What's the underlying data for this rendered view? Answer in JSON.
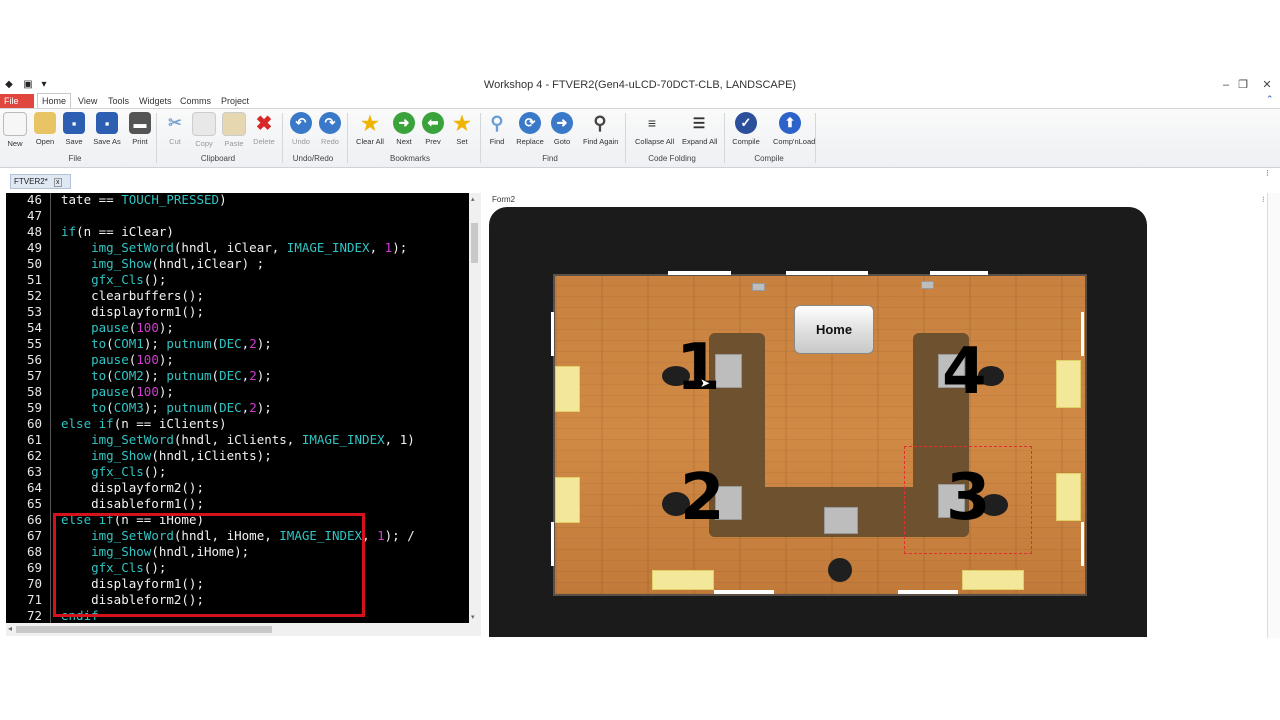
{
  "window": {
    "title": "Workshop 4 - FTVER2(Gen4-uLCD-70DCT-CLB, LANDSCAPE)",
    "minimize": "–",
    "restore": "❐",
    "close": "✕"
  },
  "menu": {
    "file": "File",
    "home": "Home",
    "view": "View",
    "tools": "Tools",
    "widgets": "Widgets",
    "comms": "Comms",
    "project": "Project"
  },
  "ribbon": {
    "buttons": {
      "new": "New",
      "open": "Open",
      "save": "Save",
      "save_as": "Save As",
      "print": "Print",
      "cut": "Cut",
      "copy": "Copy",
      "paste": "Paste",
      "delete": "Delete",
      "undo": "Undo",
      "redo": "Redo",
      "clear_all": "Clear All",
      "next": "Next",
      "prev": "Prev",
      "set": "Set",
      "find": "Find",
      "replace": "Replace",
      "goto": "Goto",
      "find_again": "Find Again",
      "collapse_all": "Collapse All",
      "expand_all": "Expand All",
      "compile": "Compile",
      "comp_load": "Comp'nLoad"
    },
    "groups": {
      "file": "File",
      "clipboard": "Clipboard",
      "undo_redo": "Undo/Redo",
      "bookmarks": "Bookmarks",
      "find": "Find",
      "code_folding": "Code Folding",
      "compile": "Compile"
    }
  },
  "doc_tab": {
    "label": "FTVER2*",
    "close": "x"
  },
  "editor": {
    "lines": [
      {
        "n": "46",
        "t": [
          [
            "plain",
            "tate == "
          ],
          [
            "fn",
            "TOUCH_PRESSED"
          ],
          [
            "plain",
            ")"
          ]
        ]
      },
      {
        "n": "47",
        "t": []
      },
      {
        "n": "48",
        "t": [
          [
            "fn",
            "if"
          ],
          [
            "plain",
            "(n == iClear)"
          ]
        ]
      },
      {
        "n": "49",
        "t": [
          [
            "plain",
            "    "
          ],
          [
            "fn",
            "img_SetWord"
          ],
          [
            "plain",
            "(hndl, iClear, "
          ],
          [
            "fn",
            "IMAGE_INDEX"
          ],
          [
            "plain",
            ", "
          ],
          [
            "num",
            "1"
          ],
          [
            "plain",
            ");"
          ]
        ]
      },
      {
        "n": "50",
        "t": [
          [
            "plain",
            "    "
          ],
          [
            "fn",
            "img_Show"
          ],
          [
            "plain",
            "(hndl,iClear) ;"
          ]
        ]
      },
      {
        "n": "51",
        "t": [
          [
            "plain",
            "    "
          ],
          [
            "fn",
            "gfx_Cls"
          ],
          [
            "plain",
            "();"
          ]
        ]
      },
      {
        "n": "52",
        "t": [
          [
            "plain",
            "    clearbuffers();"
          ]
        ]
      },
      {
        "n": "53",
        "t": [
          [
            "plain",
            "    displayform1();"
          ]
        ]
      },
      {
        "n": "54",
        "t": [
          [
            "plain",
            "    "
          ],
          [
            "fn",
            "pause"
          ],
          [
            "plain",
            "("
          ],
          [
            "num",
            "100"
          ],
          [
            "plain",
            ");"
          ]
        ]
      },
      {
        "n": "55",
        "t": [
          [
            "plain",
            "    "
          ],
          [
            "fn",
            "to"
          ],
          [
            "plain",
            "("
          ],
          [
            "fn",
            "COM1"
          ],
          [
            "plain",
            "); "
          ],
          [
            "fn",
            "putnum"
          ],
          [
            "plain",
            "("
          ],
          [
            "fn",
            "DEC"
          ],
          [
            "plain",
            ","
          ],
          [
            "num",
            "2"
          ],
          [
            "plain",
            ");"
          ]
        ]
      },
      {
        "n": "56",
        "t": [
          [
            "plain",
            "    "
          ],
          [
            "fn",
            "pause"
          ],
          [
            "plain",
            "("
          ],
          [
            "num",
            "100"
          ],
          [
            "plain",
            ");"
          ]
        ]
      },
      {
        "n": "57",
        "t": [
          [
            "plain",
            "    "
          ],
          [
            "fn",
            "to"
          ],
          [
            "plain",
            "("
          ],
          [
            "fn",
            "COM2"
          ],
          [
            "plain",
            "); "
          ],
          [
            "fn",
            "putnum"
          ],
          [
            "plain",
            "("
          ],
          [
            "fn",
            "DEC"
          ],
          [
            "plain",
            ","
          ],
          [
            "num",
            "2"
          ],
          [
            "plain",
            ");"
          ]
        ]
      },
      {
        "n": "58",
        "t": [
          [
            "plain",
            "    "
          ],
          [
            "fn",
            "pause"
          ],
          [
            "plain",
            "("
          ],
          [
            "num",
            "100"
          ],
          [
            "plain",
            ");"
          ]
        ]
      },
      {
        "n": "59",
        "t": [
          [
            "plain",
            "    "
          ],
          [
            "fn",
            "to"
          ],
          [
            "plain",
            "("
          ],
          [
            "fn",
            "COM3"
          ],
          [
            "plain",
            "); "
          ],
          [
            "fn",
            "putnum"
          ],
          [
            "plain",
            "("
          ],
          [
            "fn",
            "DEC"
          ],
          [
            "plain",
            ","
          ],
          [
            "num",
            "2"
          ],
          [
            "plain",
            ");"
          ]
        ]
      },
      {
        "n": "60",
        "t": [
          [
            "fn",
            "else if"
          ],
          [
            "plain",
            "(n == iClients)"
          ]
        ]
      },
      {
        "n": "61",
        "t": [
          [
            "plain",
            "    "
          ],
          [
            "fn",
            "img_SetWord"
          ],
          [
            "plain",
            "(hndl, iClients, "
          ],
          [
            "fn",
            "IMAGE_INDEX"
          ],
          [
            "plain",
            ", 1)"
          ]
        ]
      },
      {
        "n": "62",
        "t": [
          [
            "plain",
            "    "
          ],
          [
            "fn",
            "img_Show"
          ],
          [
            "plain",
            "(hndl,iClients);"
          ]
        ]
      },
      {
        "n": "63",
        "t": [
          [
            "plain",
            "    "
          ],
          [
            "fn",
            "gfx_Cls"
          ],
          [
            "plain",
            "();"
          ]
        ]
      },
      {
        "n": "64",
        "t": [
          [
            "plain",
            "    displayform2();"
          ]
        ]
      },
      {
        "n": "65",
        "t": [
          [
            "plain",
            "    disableform1();"
          ]
        ]
      },
      {
        "n": "66",
        "t": [
          [
            "fn",
            "else if"
          ],
          [
            "plain",
            "(n == iHome)"
          ]
        ]
      },
      {
        "n": "67",
        "t": [
          [
            "plain",
            "    "
          ],
          [
            "fn",
            "img_SetWord"
          ],
          [
            "plain",
            "(hndl, iHome, "
          ],
          [
            "fn",
            "IMAGE_INDEX"
          ],
          [
            "plain",
            ", "
          ],
          [
            "num",
            "1"
          ],
          [
            "plain",
            "); /"
          ]
        ]
      },
      {
        "n": "68",
        "t": [
          [
            "plain",
            "    "
          ],
          [
            "fn",
            "img_Show"
          ],
          [
            "plain",
            "(hndl,iHome);"
          ]
        ]
      },
      {
        "n": "69",
        "t": [
          [
            "plain",
            "    "
          ],
          [
            "fn",
            "gfx_Cls"
          ],
          [
            "plain",
            "();"
          ]
        ]
      },
      {
        "n": "70",
        "t": [
          [
            "plain",
            "    displayform1();"
          ]
        ]
      },
      {
        "n": "71",
        "t": [
          [
            "plain",
            "    disableform2();"
          ]
        ]
      },
      {
        "n": "72",
        "t": [
          [
            "fn",
            "endif"
          ]
        ]
      }
    ]
  },
  "form": {
    "label": "Form2",
    "home_button": "Home",
    "room_numbers": [
      "1",
      "2",
      "3",
      "4"
    ]
  }
}
